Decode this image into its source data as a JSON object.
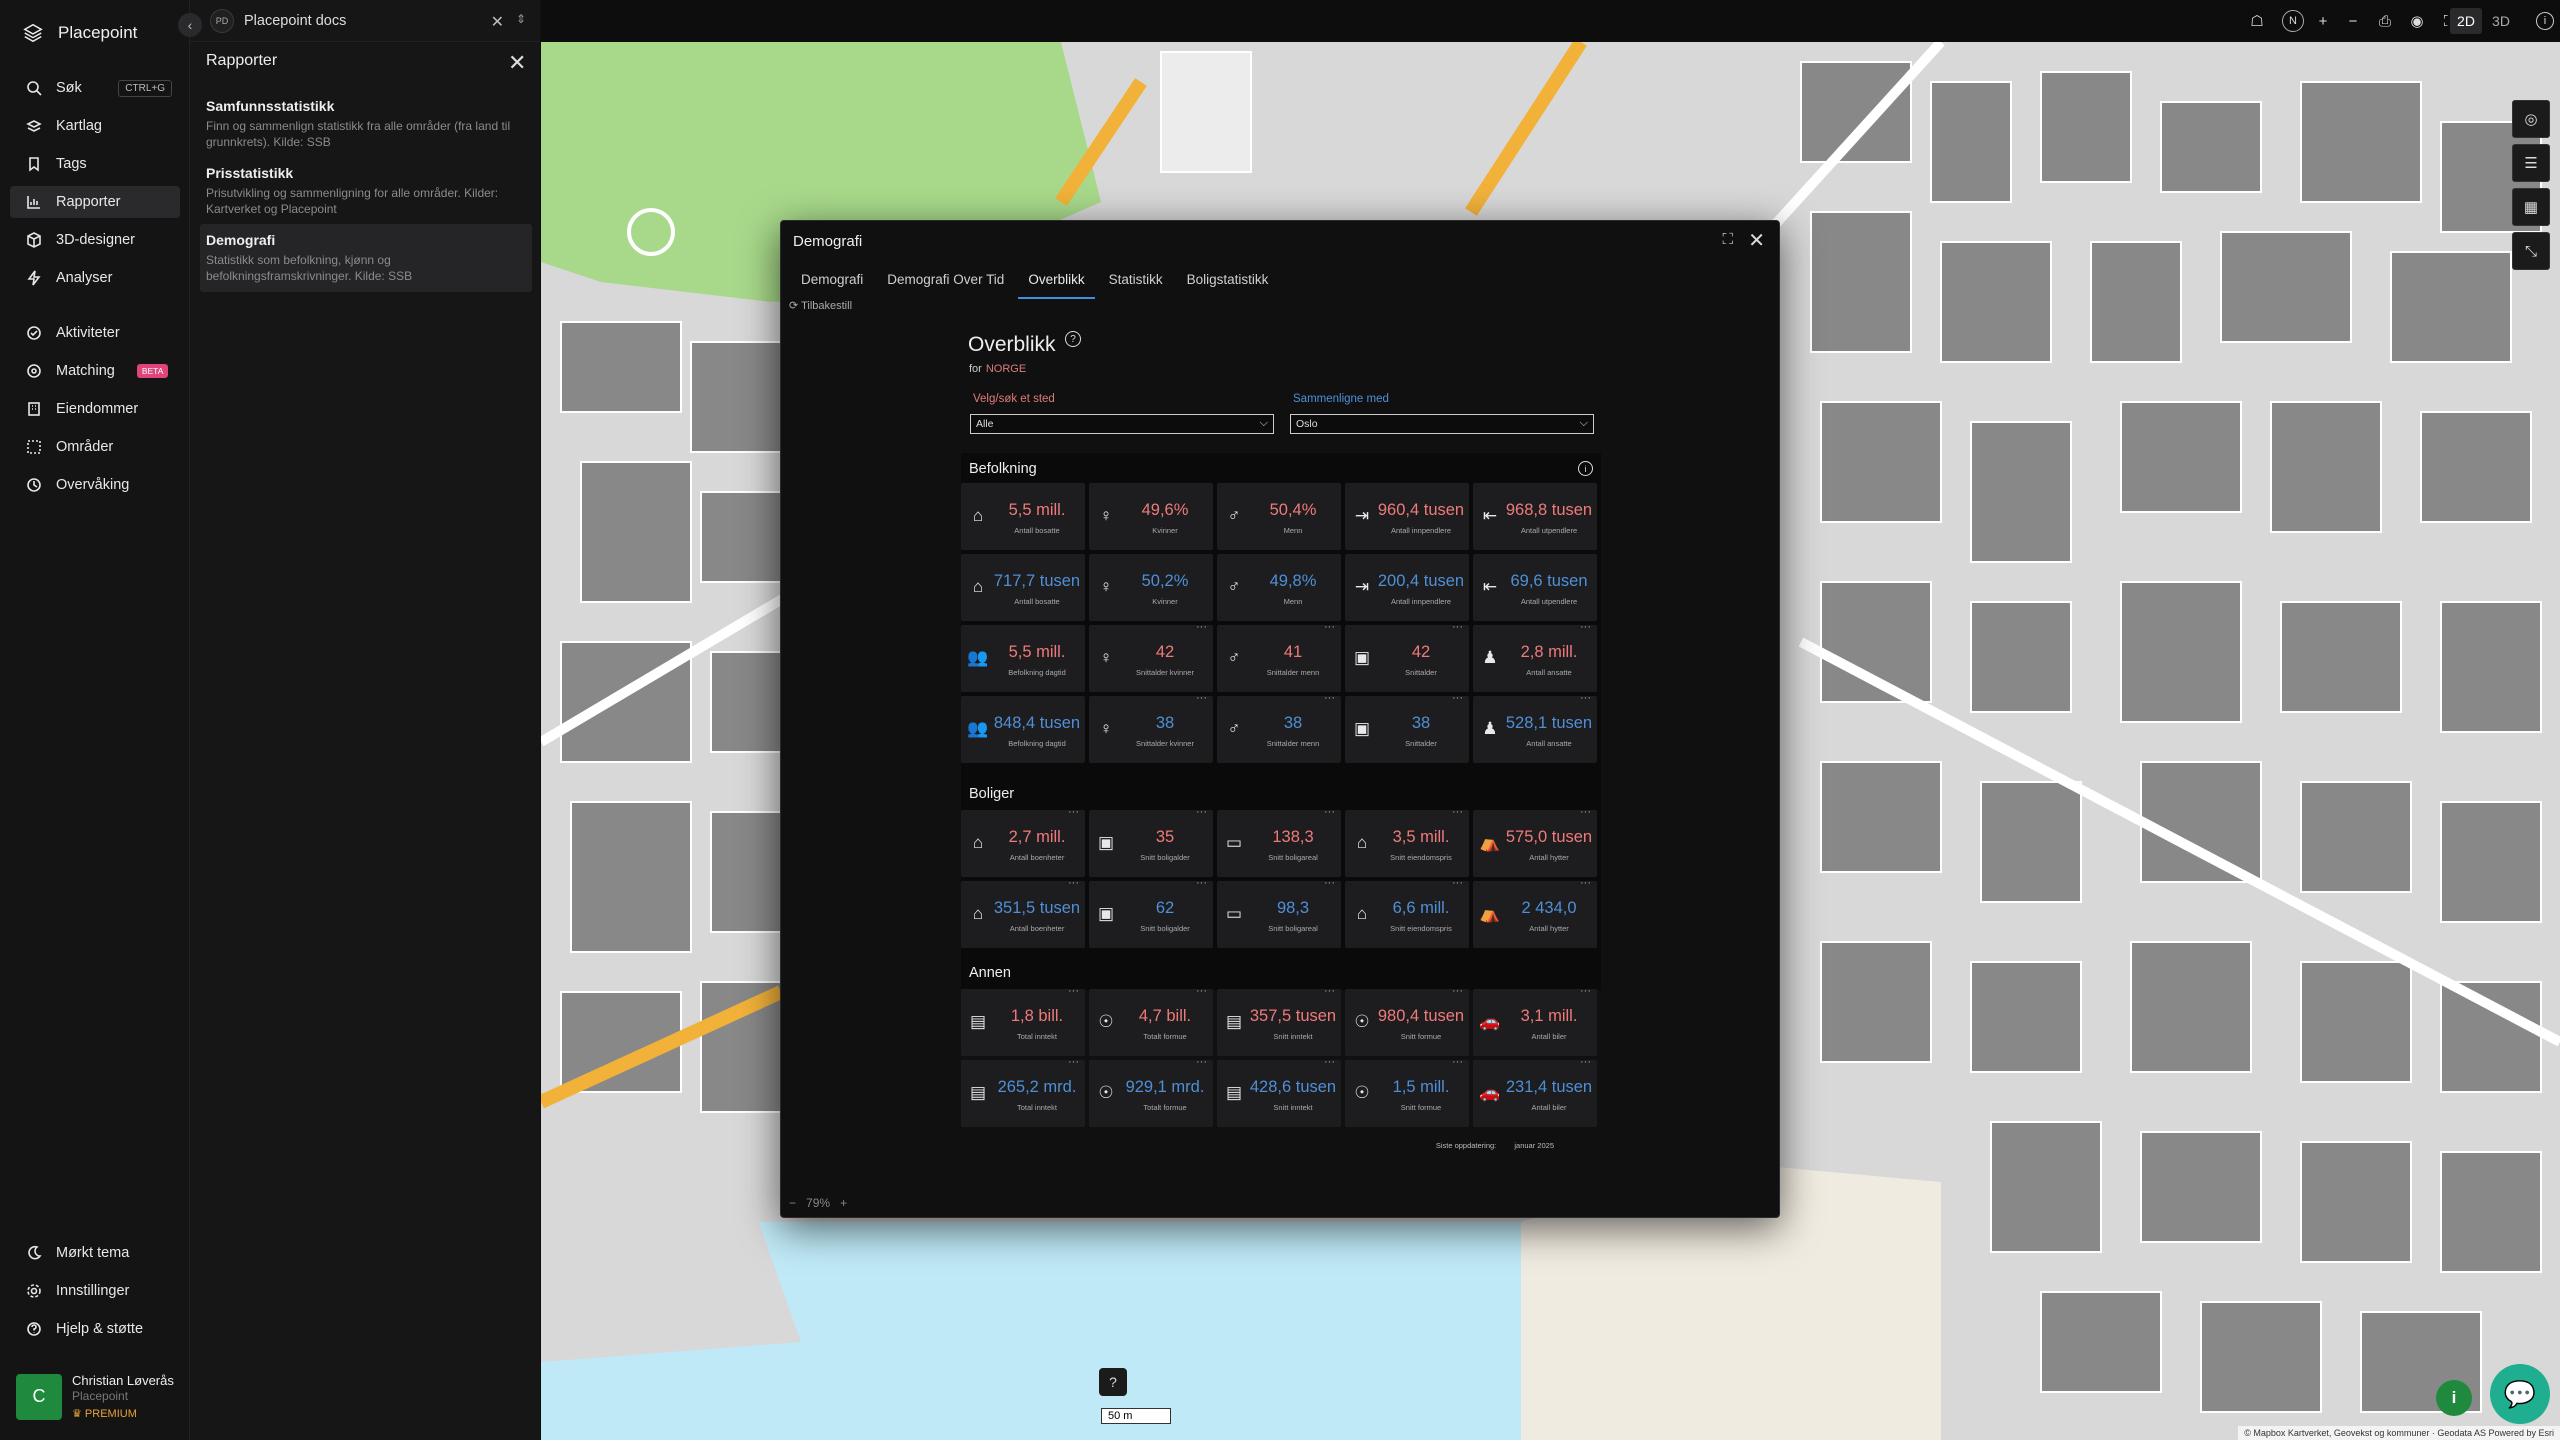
{
  "app": {
    "name": "Placepoint"
  },
  "nav": {
    "items": [
      {
        "label": "Søk",
        "shortcut": "CTRL+G"
      },
      {
        "label": "Kartlag"
      },
      {
        "label": "Tags"
      },
      {
        "label": "Rapporter"
      },
      {
        "label": "3D-designer"
      },
      {
        "label": "Analyser"
      },
      {
        "label": "Aktiviteter"
      },
      {
        "label": "Matching",
        "badge": "BETA"
      },
      {
        "label": "Eiendommer"
      },
      {
        "label": "Områder"
      },
      {
        "label": "Overvåking"
      }
    ],
    "bottom": [
      {
        "label": "Mørkt tema"
      },
      {
        "label": "Innstillinger"
      },
      {
        "label": "Hjelp & støtte"
      }
    ],
    "user": {
      "initial": "C",
      "name": "Christian Løverås",
      "org": "Placepoint",
      "plan": "PREMIUM"
    }
  },
  "doc": {
    "badge": "PD",
    "title": "Placepoint docs"
  },
  "panel": {
    "title": "Rapporter",
    "reports": [
      {
        "title": "Samfunnsstatistikk",
        "desc": "Finn og sammenlign statistikk fra alle områder (fra land til grunnkrets). Kilde: SSB"
      },
      {
        "title": "Prisstatistikk",
        "desc": "Prisutvikling og sammenligning for alle områder. Kilder: Kartverket og Placepoint"
      },
      {
        "title": "Demografi",
        "desc": "Statistikk som befolkning, kjønn og befolkningsframskrivninger. Kilde: SSB"
      }
    ]
  },
  "topbar": {
    "mode_2d": "2D",
    "mode_3d": "3D",
    "north": "N"
  },
  "map": {
    "scale": "50 m",
    "attribution": "© Mapbox  Kartverket, Geovekst og kommuner · Geodata AS  Powered by Esri"
  },
  "modal": {
    "title": "Demografi",
    "tabs": [
      "Demografi",
      "Demografi Over Tid",
      "Overblikk",
      "Statistikk",
      "Boligstatistikk"
    ],
    "active_tab": "Overblikk",
    "reset": "Tilbakestill",
    "overview": {
      "title": "Overblikk",
      "for_label": "for",
      "place": "NORGE",
      "select_label": "Velg/søk et sted",
      "select_value": "Alle",
      "compare_label": "Sammenligne med",
      "compare_value": "Oslo"
    },
    "sections": {
      "befolkning": "Befolkning",
      "boliger": "Boliger",
      "annen": "Annen"
    },
    "befolkning_cards": [
      {
        "icon": "house",
        "value": "5,5 mill.",
        "label": "Antall bosatte",
        "tone": "red",
        "dots": false
      },
      {
        "icon": "female",
        "value": "49,6%",
        "label": "Kvinner",
        "tone": "red",
        "dots": false
      },
      {
        "icon": "male",
        "value": "50,4%",
        "label": "Menn",
        "tone": "red",
        "dots": false
      },
      {
        "icon": "in",
        "value": "960,4 tusen",
        "label": "Antall innpendlere",
        "tone": "red",
        "dots": false
      },
      {
        "icon": "out",
        "value": "968,8 tusen",
        "label": "Antall utpendlere",
        "tone": "red",
        "dots": false
      },
      {
        "icon": "house",
        "value": "717,7 tusen",
        "label": "Antall bosatte",
        "tone": "blue",
        "dots": false
      },
      {
        "icon": "female",
        "value": "50,2%",
        "label": "Kvinner",
        "tone": "blue",
        "dots": false
      },
      {
        "icon": "male",
        "value": "49,8%",
        "label": "Menn",
        "tone": "blue",
        "dots": false
      },
      {
        "icon": "in",
        "value": "200,4 tusen",
        "label": "Antall innpendlere",
        "tone": "blue",
        "dots": false
      },
      {
        "icon": "out",
        "value": "69,6 tusen",
        "label": "Antall utpendlere",
        "tone": "blue",
        "dots": false
      },
      {
        "icon": "people",
        "value": "5,5 mill.",
        "label": "Befolkning dagtid",
        "tone": "red",
        "dots": false
      },
      {
        "icon": "female",
        "value": "42",
        "label": "Snittalder kvinner",
        "tone": "red",
        "dots": true
      },
      {
        "icon": "male",
        "value": "41",
        "label": "Snittalder menn",
        "tone": "red",
        "dots": true
      },
      {
        "icon": "calendar",
        "value": "42",
        "label": "Snittalder",
        "tone": "red",
        "dots": true
      },
      {
        "icon": "worker",
        "value": "2,8 mill.",
        "label": "Antall ansatte",
        "tone": "red",
        "dots": true
      },
      {
        "icon": "people",
        "value": "848,4 tusen",
        "label": "Befolkning dagtid",
        "tone": "blue",
        "dots": false
      },
      {
        "icon": "female",
        "value": "38",
        "label": "Snittalder kvinner",
        "tone": "blue",
        "dots": true
      },
      {
        "icon": "male",
        "value": "38",
        "label": "Snittalder menn",
        "tone": "blue",
        "dots": true
      },
      {
        "icon": "calendar",
        "value": "38",
        "label": "Snittalder",
        "tone": "blue",
        "dots": true
      },
      {
        "icon": "worker",
        "value": "528,1 tusen",
        "label": "Antall ansatte",
        "tone": "blue",
        "dots": true
      }
    ],
    "boliger_cards": [
      {
        "icon": "home",
        "value": "2,7 mill.",
        "label": "Antall boenheter",
        "tone": "red",
        "dots": true
      },
      {
        "icon": "calendar",
        "value": "35",
        "label": "Snitt boligalder",
        "tone": "red",
        "dots": true
      },
      {
        "icon": "area",
        "value": "138,3",
        "label": "Snitt boligareal",
        "tone": "red",
        "dots": true
      },
      {
        "icon": "price",
        "value": "3,5 mill.",
        "label": "Snitt eiendomspris",
        "tone": "red",
        "dots": true
      },
      {
        "icon": "cabin",
        "value": "575,0 tusen",
        "label": "Antall hytter",
        "tone": "red",
        "dots": true
      },
      {
        "icon": "home",
        "value": "351,5 tusen",
        "label": "Antall boenheter",
        "tone": "blue",
        "dots": true
      },
      {
        "icon": "calendar",
        "value": "62",
        "label": "Snitt boligalder",
        "tone": "blue",
        "dots": true
      },
      {
        "icon": "area",
        "value": "98,3",
        "label": "Snitt boligareal",
        "tone": "blue",
        "dots": true
      },
      {
        "icon": "price",
        "value": "6,6 mill.",
        "label": "Snitt eiendomspris",
        "tone": "blue",
        "dots": true
      },
      {
        "icon": "cabin",
        "value": "2 434,0",
        "label": "Antall hytter",
        "tone": "blue",
        "dots": true
      }
    ],
    "annen_cards": [
      {
        "icon": "money",
        "value": "1,8 bill.",
        "label": "Total inntekt",
        "tone": "red",
        "dots": true
      },
      {
        "icon": "bag",
        "value": "4,7 bill.",
        "label": "Totalt formue",
        "tone": "red",
        "dots": true
      },
      {
        "icon": "money",
        "value": "357,5 tusen",
        "label": "Snitt inntekt",
        "tone": "red",
        "dots": true
      },
      {
        "icon": "bag",
        "value": "980,4 tusen",
        "label": "Snitt formue",
        "tone": "red",
        "dots": true
      },
      {
        "icon": "car",
        "value": "3,1 mill.",
        "label": "Antall biler",
        "tone": "red",
        "dots": true
      },
      {
        "icon": "money",
        "value": "265,2 mrd.",
        "label": "Total inntekt",
        "tone": "blue",
        "dots": true
      },
      {
        "icon": "bag",
        "value": "929,1 mrd.",
        "label": "Totalt formue",
        "tone": "blue",
        "dots": true
      },
      {
        "icon": "money",
        "value": "428,6 tusen",
        "label": "Snitt inntekt",
        "tone": "blue",
        "dots": true
      },
      {
        "icon": "bag",
        "value": "1,5 mill.",
        "label": "Snitt formue",
        "tone": "blue",
        "dots": true
      },
      {
        "icon": "car",
        "value": "231,4 tusen",
        "label": "Antall biler",
        "tone": "blue",
        "dots": true
      }
    ],
    "updated_label": "Siste oppdatering:",
    "updated_value": "januar 2025",
    "zoom": "79%"
  },
  "colors": {
    "red_value": "#ef7a7a",
    "blue_value": "#4f8fd6",
    "accent": "#3d8fe0",
    "chat": "#1fae8f"
  }
}
